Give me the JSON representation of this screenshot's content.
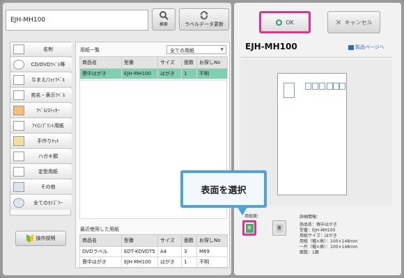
{
  "search": {
    "value": "EJH-MH100",
    "button_label": "検索"
  },
  "update_button_label": "ラベルデータ更新",
  "categories": [
    {
      "label": "名刺"
    },
    {
      "label": "CD/DVDﾗﾍﾞﾙ等"
    },
    {
      "label": "なまえ/ﾌｫﾄﾗﾍﾞﾙ"
    },
    {
      "label": "宛名・表示ﾗﾍﾞﾙ"
    },
    {
      "label": "ﾗﾍﾞﾙ/ｽﾃｯｶｰ"
    },
    {
      "label": "ｱｲﾛﾝﾌﾟﾘﾝﾄ用紙"
    },
    {
      "label": "手作りｷｯﾄ"
    },
    {
      "label": "ハガキ類"
    },
    {
      "label": "定型用紙"
    },
    {
      "label": "その他"
    },
    {
      "label": "全てのｶﾃｺﾞﾘｰ"
    }
  ],
  "help_button_label": "操作説明",
  "paper_list": {
    "title": "用紙一覧",
    "filter": "全ての用紙",
    "columns": [
      "商品名",
      "型番",
      "サイズ",
      "面数",
      "お探しNo"
    ],
    "rows": [
      [
        "喪中はがき",
        "EJH-MH100",
        "はがき",
        "1",
        "不明"
      ]
    ]
  },
  "recent_list": {
    "title": "最近使用した用紙",
    "columns": [
      "商品名",
      "型番",
      "サイズ",
      "面数",
      "お探しNo"
    ],
    "rows": [
      [
        "DVDラベル",
        "EDT-KDVDT5",
        "A4",
        "3",
        "M69"
      ],
      [
        "喪中はがき",
        "EJH-MH100",
        "はがき",
        "1",
        "不明"
      ]
    ]
  },
  "ok_label": "OK",
  "cancel_label": "キャンセル",
  "product": {
    "name": "EJH-MH100",
    "link_label": "製品ページへ"
  },
  "surface": {
    "label": "用紙面：",
    "front": "表",
    "back": "裏"
  },
  "details": {
    "title": "詳細情報：",
    "lines": "商品名：喪中はがき\n型番：EJH-MH100\n用紙サイズ：はがき\n用紙（幅×高）：100×148mm\n一片（幅×高）：100×148mm\n面数：1面"
  },
  "callout_text": "表面を選択",
  "colors": {
    "selected_row": "#7fd0b0",
    "highlight_border": "#e0318a",
    "callout": "#4da3dd",
    "ok_icon": "#3a9a6b"
  }
}
